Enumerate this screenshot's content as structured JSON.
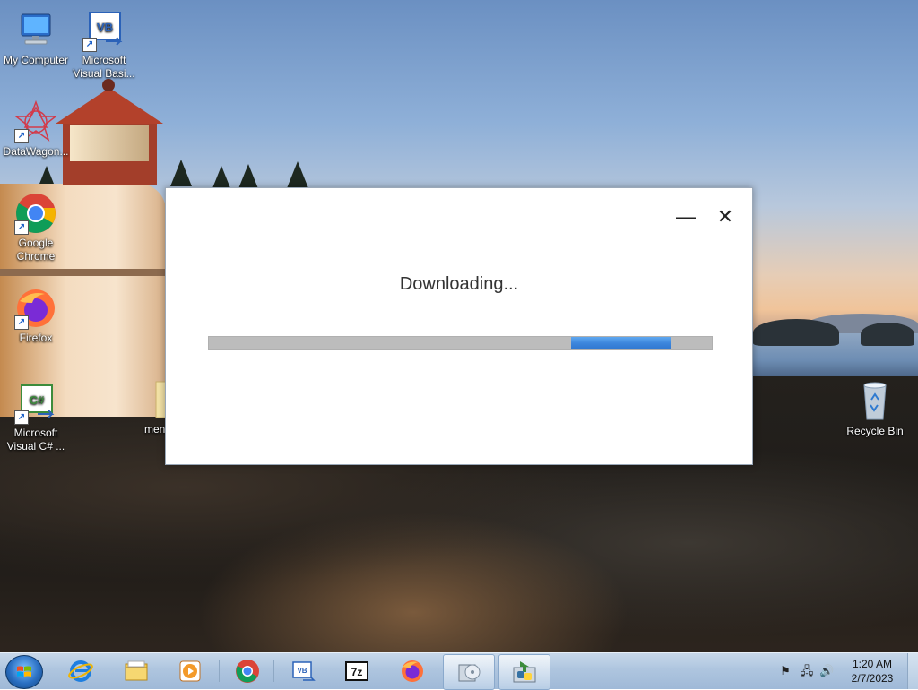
{
  "desktop": {
    "icons": [
      {
        "label": "My Computer",
        "icon": "computer-icon"
      },
      {
        "label": "Microsoft Visual Basi...",
        "icon": "visual-basic-icon"
      },
      {
        "label": "DataWagon...",
        "icon": "datawagon-icon"
      },
      {
        "label": "Google Chrome",
        "icon": "chrome-icon"
      },
      {
        "label": "Firefox",
        "icon": "firefox-icon"
      },
      {
        "label": "Microsoft Visual C# ...",
        "icon": "visual-csharp-icon"
      },
      {
        "label": "men",
        "icon": "folder-icon"
      },
      {
        "label": "Recycle Bin",
        "icon": "recycle-bin-icon"
      }
    ]
  },
  "dialog": {
    "status_text": "Downloading...",
    "minimize_glyph": "—",
    "close_glyph": "✕",
    "progress": {
      "mode": "marquee",
      "chunk_start": 0.72,
      "chunk_end": 0.918
    }
  },
  "taskbar": {
    "items": [
      {
        "icon": "internet-explorer-icon"
      },
      {
        "icon": "file-explorer-icon"
      },
      {
        "icon": "media-player-icon"
      },
      {
        "icon": "chrome-icon"
      },
      {
        "icon": "visual-basic-icon"
      },
      {
        "icon": "7zip-icon",
        "text": "7z"
      },
      {
        "icon": "firefox-icon"
      },
      {
        "icon": "installer-disc-icon",
        "active": true
      },
      {
        "icon": "python-installer-icon",
        "active": true
      }
    ],
    "clock": {
      "time": "1:20 AM",
      "date": "2/7/2023"
    }
  },
  "colors": {
    "progress_track": "#bcbcbc",
    "progress_chunk": "#3d86dc",
    "taskbar": "#aec5df"
  }
}
